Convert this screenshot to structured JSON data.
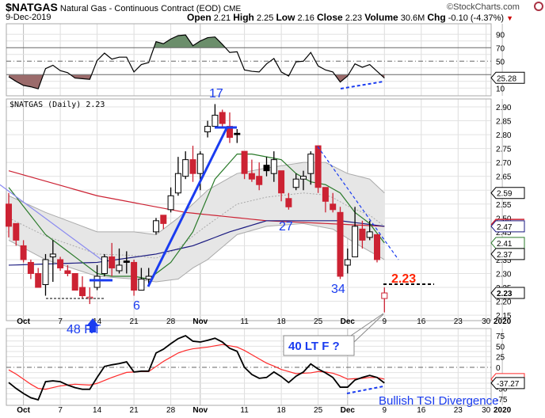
{
  "header": {
    "symbol": "$NATGAS",
    "name": "Natural Gas - Continuous Contract (EOD)",
    "exchange": "CME",
    "brand": "©StockCharts.com",
    "date": "9-Dec-2019",
    "open_label": "Open",
    "open": "2.21",
    "high_label": "High",
    "high": "2.25",
    "low_label": "Low",
    "low": "2.16",
    "close_label": "Close",
    "close": "2.23",
    "volume_label": "Volume",
    "volume": "30.6M",
    "chg_label": "Chg",
    "chg": "-0.10 (-4.37%)"
  },
  "colors": {
    "up": "#000000",
    "down": "#cc2233",
    "ema": "#2a7a2a",
    "ma200": "#cc2233",
    "ma50": "#1a1a80",
    "band": "#e6e6e6",
    "rsi_hi": "#6b8e6b",
    "rsi_lo": "#9b6b6b",
    "annot": "#1a3cf0",
    "annot_red": "#ff2200"
  },
  "main_label": "$NATGAS (Daily) 2.23",
  "annotations": {
    "wave17": "17",
    "wave6": "6",
    "wave27": "27",
    "wave34": "34",
    "price_223": "2.23",
    "rt48": "48 RT",
    "ltf40": "40 LT F ?",
    "tsi_div": "Bullish TSI Divergence"
  },
  "tags": {
    "rsi": "25.28",
    "bb_upper": "2.59",
    "ma200": "2.47",
    "ema": "2.41",
    "bb_mid": "2.37",
    "close": "2.23",
    "tsi": "-37.27"
  },
  "chart_data": [
    {
      "type": "candlestick",
      "title": "$NATGAS (Daily)",
      "ylim": [
        2.13,
        2.93
      ],
      "yticks": [
        "2.15",
        "2.20",
        "2.25",
        "2.30",
        "2.35",
        "2.40",
        "2.45",
        "2.50",
        "2.55",
        "2.60",
        "2.65",
        "2.70",
        "2.75",
        "2.80",
        "2.85",
        "2.90"
      ],
      "xticks": [
        {
          "label": "Oct",
          "bar": 2,
          "bold": true
        },
        {
          "label": "7",
          "bar": 7
        },
        {
          "label": "14",
          "bar": 12
        },
        {
          "label": "21",
          "bar": 17
        },
        {
          "label": "28",
          "bar": 22
        },
        {
          "label": "Nov",
          "bar": 26,
          "bold": true
        },
        {
          "label": "11",
          "bar": 32
        },
        {
          "label": "18",
          "bar": 37
        },
        {
          "label": "25",
          "bar": 42
        },
        {
          "label": "Dec",
          "bar": 46,
          "bold": true
        },
        {
          "label": "9",
          "bar": 51
        },
        {
          "label": "16",
          "bar": 56
        },
        {
          "label": "23",
          "bar": 61
        },
        {
          "label": "30",
          "bar": 64.8
        },
        {
          "label": "2020",
          "bar": 67,
          "bold": true
        }
      ],
      "ohlc": [
        [
          2.55,
          2.59,
          2.43,
          2.47
        ],
        [
          2.48,
          2.48,
          2.4,
          2.42
        ],
        [
          2.4,
          2.42,
          2.34,
          2.35
        ],
        [
          2.34,
          2.35,
          2.28,
          2.3
        ],
        [
          2.3,
          2.32,
          2.25,
          2.25
        ],
        [
          2.26,
          2.37,
          2.22,
          2.35
        ],
        [
          2.36,
          2.42,
          2.27,
          2.37
        ],
        [
          2.35,
          2.36,
          2.31,
          2.32
        ],
        [
          2.31,
          2.33,
          2.29,
          2.3
        ],
        [
          2.3,
          2.3,
          2.24,
          2.24
        ],
        [
          2.25,
          2.29,
          2.21,
          2.22
        ],
        [
          2.21,
          2.25,
          2.19,
          2.215
        ],
        [
          2.25,
          2.33,
          2.24,
          2.29
        ],
        [
          2.3,
          2.37,
          2.29,
          2.36
        ],
        [
          2.36,
          2.41,
          2.29,
          2.32
        ],
        [
          2.31,
          2.39,
          2.3,
          2.33
        ],
        [
          2.345,
          2.38,
          2.3,
          2.34
        ],
        [
          2.34,
          2.35,
          2.22,
          2.24
        ],
        [
          2.24,
          2.32,
          2.24,
          2.28
        ],
        [
          2.28,
          2.32,
          2.26,
          2.29
        ],
        [
          2.45,
          2.5,
          2.44,
          2.49
        ],
        [
          2.51,
          2.51,
          2.46,
          2.48
        ],
        [
          2.53,
          2.61,
          2.52,
          2.58
        ],
        [
          2.59,
          2.72,
          2.58,
          2.66
        ],
        [
          2.65,
          2.74,
          2.64,
          2.71
        ],
        [
          2.71,
          2.76,
          2.63,
          2.66
        ],
        [
          2.66,
          2.74,
          2.6,
          2.73
        ],
        [
          2.81,
          2.85,
          2.79,
          2.83
        ],
        [
          2.83,
          2.91,
          2.83,
          2.87
        ],
        [
          2.88,
          2.89,
          2.83,
          2.84
        ],
        [
          2.83,
          2.88,
          2.77,
          2.79
        ],
        [
          2.805,
          2.82,
          2.77,
          2.8
        ],
        [
          2.74,
          2.74,
          2.64,
          2.66
        ],
        [
          2.66,
          2.71,
          2.63,
          2.64
        ],
        [
          2.65,
          2.7,
          2.6,
          2.62
        ],
        [
          2.69,
          2.72,
          2.65,
          2.67
        ],
        [
          2.66,
          2.74,
          2.63,
          2.71
        ],
        [
          2.67,
          2.67,
          2.56,
          2.59
        ],
        [
          2.57,
          2.59,
          2.53,
          2.54
        ],
        [
          2.61,
          2.66,
          2.6,
          2.64
        ],
        [
          2.64,
          2.67,
          2.6,
          2.65
        ],
        [
          2.66,
          2.74,
          2.62,
          2.73
        ],
        [
          2.76,
          2.76,
          2.59,
          2.61
        ],
        [
          2.61,
          2.61,
          2.52,
          2.56
        ],
        [
          2.55,
          2.59,
          2.52,
          2.53
        ],
        [
          2.52,
          2.54,
          2.28,
          2.29
        ],
        [
          2.33,
          2.39,
          2.3,
          2.35
        ],
        [
          2.36,
          2.54,
          2.36,
          2.47
        ],
        [
          2.46,
          2.49,
          2.39,
          2.42
        ],
        [
          2.43,
          2.49,
          2.42,
          2.45
        ],
        [
          2.44,
          2.44,
          2.34,
          2.35
        ],
        [
          2.21,
          2.25,
          2.16,
          2.23
        ]
      ],
      "overlays": {
        "bb_upper": [
          [
            0,
            2.58
          ],
          [
            5,
            2.52
          ],
          [
            12,
            2.45
          ],
          [
            17,
            2.45
          ],
          [
            20,
            2.44
          ],
          [
            23,
            2.5
          ],
          [
            27,
            2.6
          ],
          [
            31,
            2.66
          ],
          [
            35,
            2.68
          ],
          [
            40,
            2.7
          ],
          [
            43,
            2.7
          ],
          [
            46,
            2.66
          ],
          [
            49,
            2.64
          ],
          [
            51,
            2.59
          ]
        ],
        "bb_lower": [
          [
            0,
            2.42
          ],
          [
            5,
            2.35
          ],
          [
            12,
            2.29
          ],
          [
            17,
            2.28
          ],
          [
            20,
            2.27
          ],
          [
            23,
            2.28
          ],
          [
            25,
            2.32
          ],
          [
            27,
            2.35
          ],
          [
            31,
            2.44
          ],
          [
            35,
            2.47
          ],
          [
            40,
            2.48
          ],
          [
            44,
            2.46
          ],
          [
            47,
            2.41
          ],
          [
            51,
            2.35
          ]
        ],
        "ema": [
          [
            0,
            2.61
          ],
          [
            5,
            2.44
          ],
          [
            10,
            2.34
          ],
          [
            12,
            2.3
          ],
          [
            14,
            2.29
          ],
          [
            17,
            2.29
          ],
          [
            19,
            2.28
          ],
          [
            22,
            2.34
          ],
          [
            25,
            2.45
          ],
          [
            28,
            2.64
          ],
          [
            31,
            2.73
          ],
          [
            33,
            2.73
          ],
          [
            35,
            2.72
          ],
          [
            37,
            2.71
          ],
          [
            39,
            2.66
          ],
          [
            41,
            2.63
          ],
          [
            43,
            2.62
          ],
          [
            45,
            2.59
          ],
          [
            47,
            2.52
          ],
          [
            49,
            2.48
          ],
          [
            51,
            2.41
          ]
        ],
        "ma200": [
          [
            0,
            2.67
          ],
          [
            12,
            2.58
          ],
          [
            24,
            2.52
          ],
          [
            35,
            2.49
          ],
          [
            51,
            2.47
          ]
        ],
        "ma50": [
          [
            0,
            2.33
          ],
          [
            12,
            2.34
          ],
          [
            20,
            2.37
          ],
          [
            25,
            2.4
          ],
          [
            30,
            2.45
          ],
          [
            35,
            2.49
          ],
          [
            45,
            2.49
          ],
          [
            51,
            2.47
          ]
        ],
        "downtrend": [
          [
            -1.2,
            2.62
          ],
          [
            13.1,
            2.34
          ]
        ]
      }
    },
    {
      "type": "line",
      "title": "RSI",
      "ylim": [
        0,
        100
      ],
      "yticks": [
        "90",
        "70",
        "50",
        "10"
      ],
      "levels": [
        70,
        50,
        30
      ],
      "values": [
        27,
        20,
        14,
        12,
        9,
        39,
        44,
        36,
        33,
        25,
        24,
        23,
        51,
        62,
        53,
        56,
        56,
        34,
        45,
        48,
        79,
        76,
        83,
        88,
        89,
        73,
        80,
        85,
        86,
        75,
        63,
        64,
        37,
        35,
        34,
        46,
        54,
        34,
        28,
        49,
        50,
        63,
        43,
        37,
        34,
        19,
        28,
        46,
        41,
        45,
        35,
        25
      ]
    },
    {
      "type": "line",
      "title": "TSI",
      "ylim": [
        -85,
        85
      ],
      "yticks": [
        "75",
        "50",
        "25",
        "0",
        "-25",
        "-50",
        "-75"
      ],
      "series": [
        {
          "name": "TSI",
          "values": [
            -36,
            -50,
            -62,
            -72,
            -77,
            -34,
            -32,
            -34,
            -42,
            -48,
            -52,
            -52,
            -24,
            2,
            6,
            9,
            13,
            -11,
            -9,
            -9,
            34,
            43,
            56,
            68,
            75,
            62,
            60,
            64,
            69,
            60,
            45,
            38,
            0,
            -17,
            -26,
            -24,
            -11,
            -22,
            -36,
            -21,
            -11,
            8,
            -4,
            -13,
            -24,
            -47,
            -47,
            -30,
            -24,
            -19,
            -24,
            -37
          ]
        },
        {
          "name": "Signal",
          "values": [
            -6,
            -16,
            -28,
            -40,
            -50,
            -52,
            -48,
            -44,
            -42,
            -40,
            -41,
            -42,
            -38,
            -31,
            -24,
            -18,
            -12,
            -11,
            -10,
            -10,
            2,
            14,
            24,
            34,
            40,
            44,
            46,
            48,
            51,
            54,
            51,
            48,
            40,
            30,
            20,
            10,
            3,
            -5,
            -10,
            -15,
            -14,
            -13,
            -10,
            -11,
            -14,
            -20,
            -28,
            -27,
            -26,
            -24,
            -24,
            -28
          ]
        }
      ]
    }
  ]
}
